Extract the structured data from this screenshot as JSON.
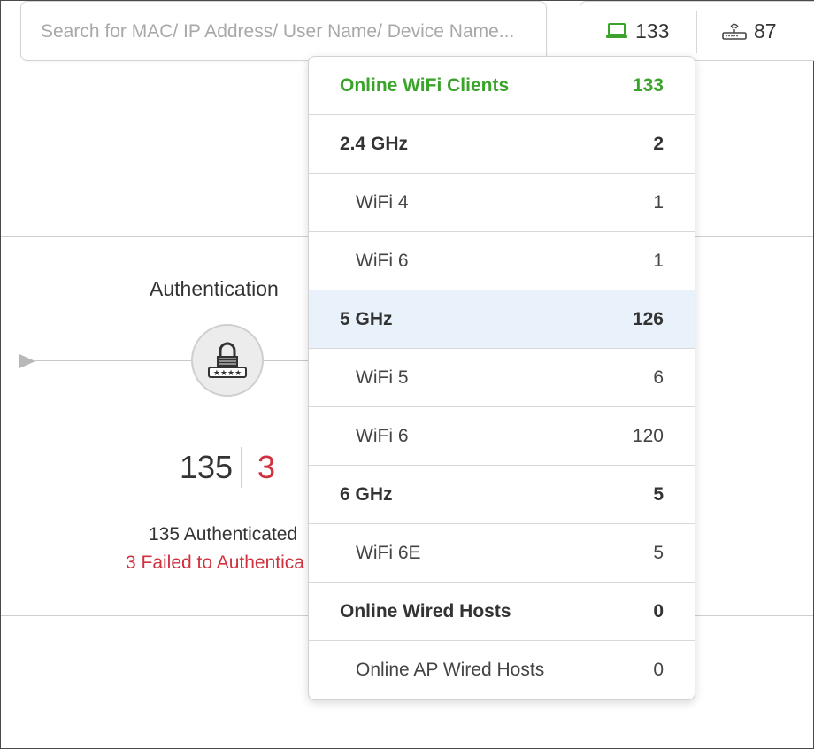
{
  "search": {
    "placeholder": "Search for MAC/ IP Address/ User Name/ Device Name..."
  },
  "top_stats": {
    "clients_count": "133",
    "aps_count": "87",
    "icons": {
      "clients": "laptop-icon",
      "aps": "access-point-icon"
    }
  },
  "auth": {
    "title": "Authentication",
    "authenticated_count": "135",
    "failed_count": "3",
    "authenticated_text": "135 Authenticated",
    "failed_text": "3 Failed to Authentica",
    "icon": "lock-icon"
  },
  "colors": {
    "green": "#3aa32a",
    "red": "#d0313f",
    "selected_row": "#e9f2fb"
  },
  "dropdown": {
    "rows": [
      {
        "label": "Online WiFi Clients",
        "value": "133",
        "type": "green"
      },
      {
        "label": "2.4 GHz",
        "value": "2",
        "type": "head"
      },
      {
        "label": "WiFi 4",
        "value": "1",
        "type": "sub"
      },
      {
        "label": "WiFi 6",
        "value": "1",
        "type": "sub"
      },
      {
        "label": "5 GHz",
        "value": "126",
        "type": "head",
        "selected": true
      },
      {
        "label": "WiFi 5",
        "value": "6",
        "type": "sub"
      },
      {
        "label": "WiFi 6",
        "value": "120",
        "type": "sub"
      },
      {
        "label": "6 GHz",
        "value": "5",
        "type": "head"
      },
      {
        "label": "WiFi 6E",
        "value": "5",
        "type": "sub"
      },
      {
        "label": "Online Wired Hosts",
        "value": "0",
        "type": "head"
      },
      {
        "label": "Online AP Wired Hosts",
        "value": "0",
        "type": "sub"
      }
    ]
  }
}
